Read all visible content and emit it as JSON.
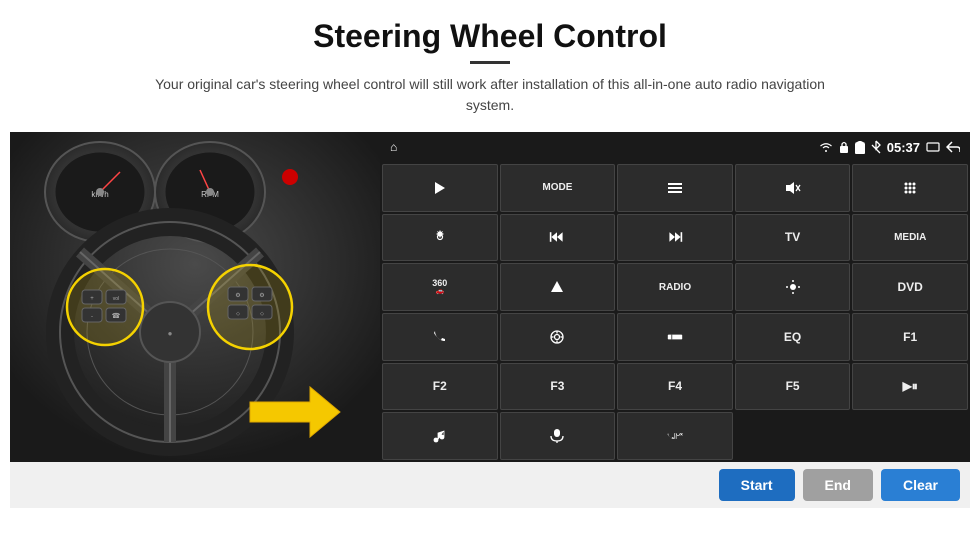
{
  "header": {
    "title": "Steering Wheel Control",
    "subtitle": "Your original car's steering wheel control will still work after installation of this all-in-one auto radio navigation system."
  },
  "status_bar": {
    "time": "05:37",
    "home_icon": "⌂",
    "wifi_icon": "wifi",
    "lock_icon": "🔒",
    "sd_icon": "sd",
    "bt_icon": "bt",
    "window_icon": "▭",
    "back_icon": "↩"
  },
  "buttons": [
    {
      "id": "r1c1",
      "label": "➤",
      "type": "icon"
    },
    {
      "id": "r1c2",
      "label": "MODE",
      "type": "text"
    },
    {
      "id": "r1c3",
      "label": "≡",
      "type": "icon"
    },
    {
      "id": "r1c4",
      "label": "🔇",
      "type": "icon"
    },
    {
      "id": "r1c5",
      "label": "⠿",
      "type": "icon"
    },
    {
      "id": "r2c1",
      "label": "⚙",
      "type": "icon"
    },
    {
      "id": "r2c2",
      "label": "⏮",
      "type": "icon"
    },
    {
      "id": "r2c3",
      "label": "⏭",
      "type": "icon"
    },
    {
      "id": "r2c4",
      "label": "TV",
      "type": "text"
    },
    {
      "id": "r2c5",
      "label": "MEDIA",
      "type": "text"
    },
    {
      "id": "r3c1",
      "label": "360°",
      "type": "text"
    },
    {
      "id": "r3c2",
      "label": "▲",
      "type": "icon"
    },
    {
      "id": "r3c3",
      "label": "RADIO",
      "type": "text"
    },
    {
      "id": "r3c4",
      "label": "☀",
      "type": "icon"
    },
    {
      "id": "r3c5",
      "label": "DVD",
      "type": "text"
    },
    {
      "id": "r4c1",
      "label": "📞",
      "type": "icon"
    },
    {
      "id": "r4c2",
      "label": "◎",
      "type": "icon"
    },
    {
      "id": "r4c3",
      "label": "▬",
      "type": "icon"
    },
    {
      "id": "r4c4",
      "label": "EQ",
      "type": "text"
    },
    {
      "id": "r4c5",
      "label": "F1",
      "type": "text"
    },
    {
      "id": "r5c1",
      "label": "F2",
      "type": "text"
    },
    {
      "id": "r5c2",
      "label": "F3",
      "type": "text"
    },
    {
      "id": "r5c3",
      "label": "F4",
      "type": "text"
    },
    {
      "id": "r5c4",
      "label": "F5",
      "type": "text"
    },
    {
      "id": "r5c5",
      "label": "▶⏸",
      "type": "text"
    },
    {
      "id": "r6c1",
      "label": "♪",
      "type": "icon"
    },
    {
      "id": "r6c2",
      "label": "🎤",
      "type": "icon"
    },
    {
      "id": "r6c3",
      "label": "📞/↩",
      "type": "text"
    },
    {
      "id": "r6c4",
      "label": "",
      "type": "empty"
    },
    {
      "id": "r6c5",
      "label": "",
      "type": "empty"
    }
  ],
  "bottom_buttons": {
    "start": "Start",
    "end": "End",
    "clear": "Clear"
  }
}
